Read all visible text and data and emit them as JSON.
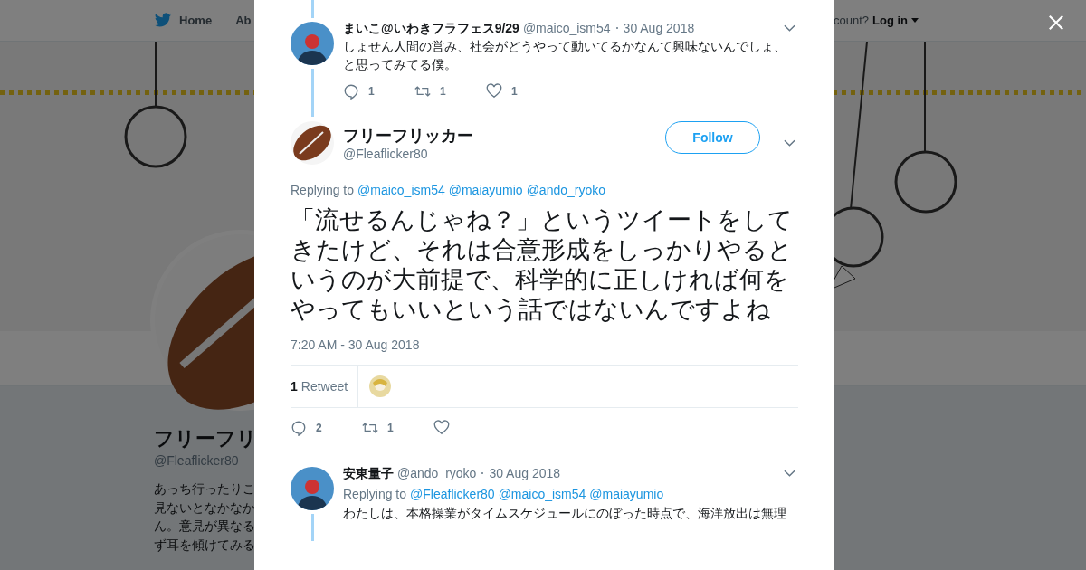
{
  "top_nav": {
    "items": [
      {
        "label": "Home"
      },
      {
        "label": "Ab"
      }
    ],
    "account_prompt": "count?",
    "login": "Log in"
  },
  "profile": {
    "name": "フリーフリ",
    "handle": "@Fleaflicker80",
    "bio_lines": [
      "あっち行ったりこ",
      "見ないとなかなか",
      "ん。意見が異なる",
      "ず耳を傾けてみる"
    ]
  },
  "modal": {
    "tweets": [
      {
        "kind": "compact",
        "thread_above": true,
        "thread_below": true,
        "name": "まいこ@いわきフラフェス9/29",
        "handle": "@maico_ism54",
        "date": "30 Aug 2018",
        "text_lines": [
          "しょせん人間の営み、社会がどうやって動いてるかなんて興味ないんでしょ、",
          "と思ってみてる僕。"
        ],
        "replies": "1",
        "retweets": "1",
        "likes": "1"
      },
      {
        "kind": "focused",
        "name": "フリーフリッカー",
        "handle": "@Fleaflicker80",
        "follow": "Follow",
        "replying_prefix": "Replying to",
        "replying_to": [
          "@maico_ism54",
          "@maiayumio",
          "@ando_ryoko"
        ],
        "text": "「流せるんじゃね？」というツイートをしてきたけど、それは合意形成をしっかりやるというのが大前提で、科学的に正しければ何をやってもいいという話ではないんですよね",
        "timestamp": "7:20 AM - 30 Aug 2018",
        "retweet_count": "1",
        "retweet_label": "Retweet",
        "replies": "2",
        "retweets": "1"
      },
      {
        "kind": "compact",
        "thread_above": false,
        "thread_below": true,
        "name": "安東量子",
        "handle": "@ando_ryoko",
        "date": "30 Aug 2018",
        "replying_prefix": "Replying to",
        "replying_to": [
          "@Fleaflicker80",
          "@maico_ism54",
          "@maiayumio"
        ],
        "text_lines": [
          "わたしは、本格操業がタイムスケジュールにのぼった時点で、海洋放出は無理"
        ]
      }
    ]
  }
}
